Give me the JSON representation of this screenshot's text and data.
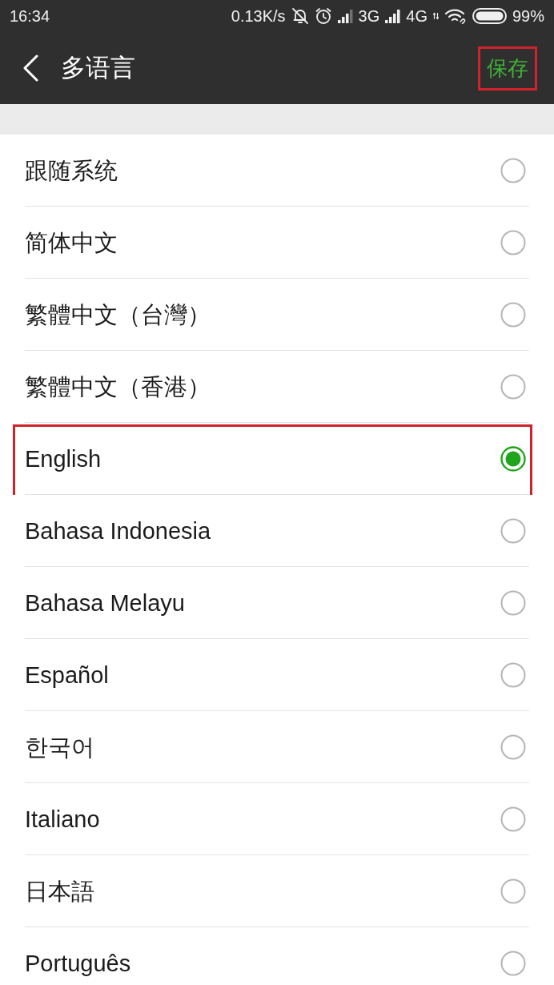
{
  "status_bar": {
    "time": "16:34",
    "network_speed": "0.13K/s",
    "mobile_networks": [
      "3G",
      "4G"
    ],
    "battery": "99%"
  },
  "title_bar": {
    "title": "多语言",
    "save_button": {
      "label": "保存",
      "highlighted": true
    }
  },
  "languages": [
    {
      "label": "跟随系统",
      "selected": false,
      "highlighted": false
    },
    {
      "label": "简体中文",
      "selected": false,
      "highlighted": false
    },
    {
      "label": "繁體中文（台灣）",
      "selected": false,
      "highlighted": false
    },
    {
      "label": "繁體中文（香港）",
      "selected": false,
      "highlighted": false
    },
    {
      "label": "English",
      "selected": true,
      "highlighted": true
    },
    {
      "label": "Bahasa Indonesia",
      "selected": false,
      "highlighted": false
    },
    {
      "label": "Bahasa Melayu",
      "selected": false,
      "highlighted": false
    },
    {
      "label": "Español",
      "selected": false,
      "highlighted": false
    },
    {
      "label": "한국어",
      "selected": false,
      "highlighted": false
    },
    {
      "label": "Italiano",
      "selected": false,
      "highlighted": false
    },
    {
      "label": "日本語",
      "selected": false,
      "highlighted": false
    },
    {
      "label": "Português",
      "selected": false,
      "highlighted": false
    }
  ]
}
